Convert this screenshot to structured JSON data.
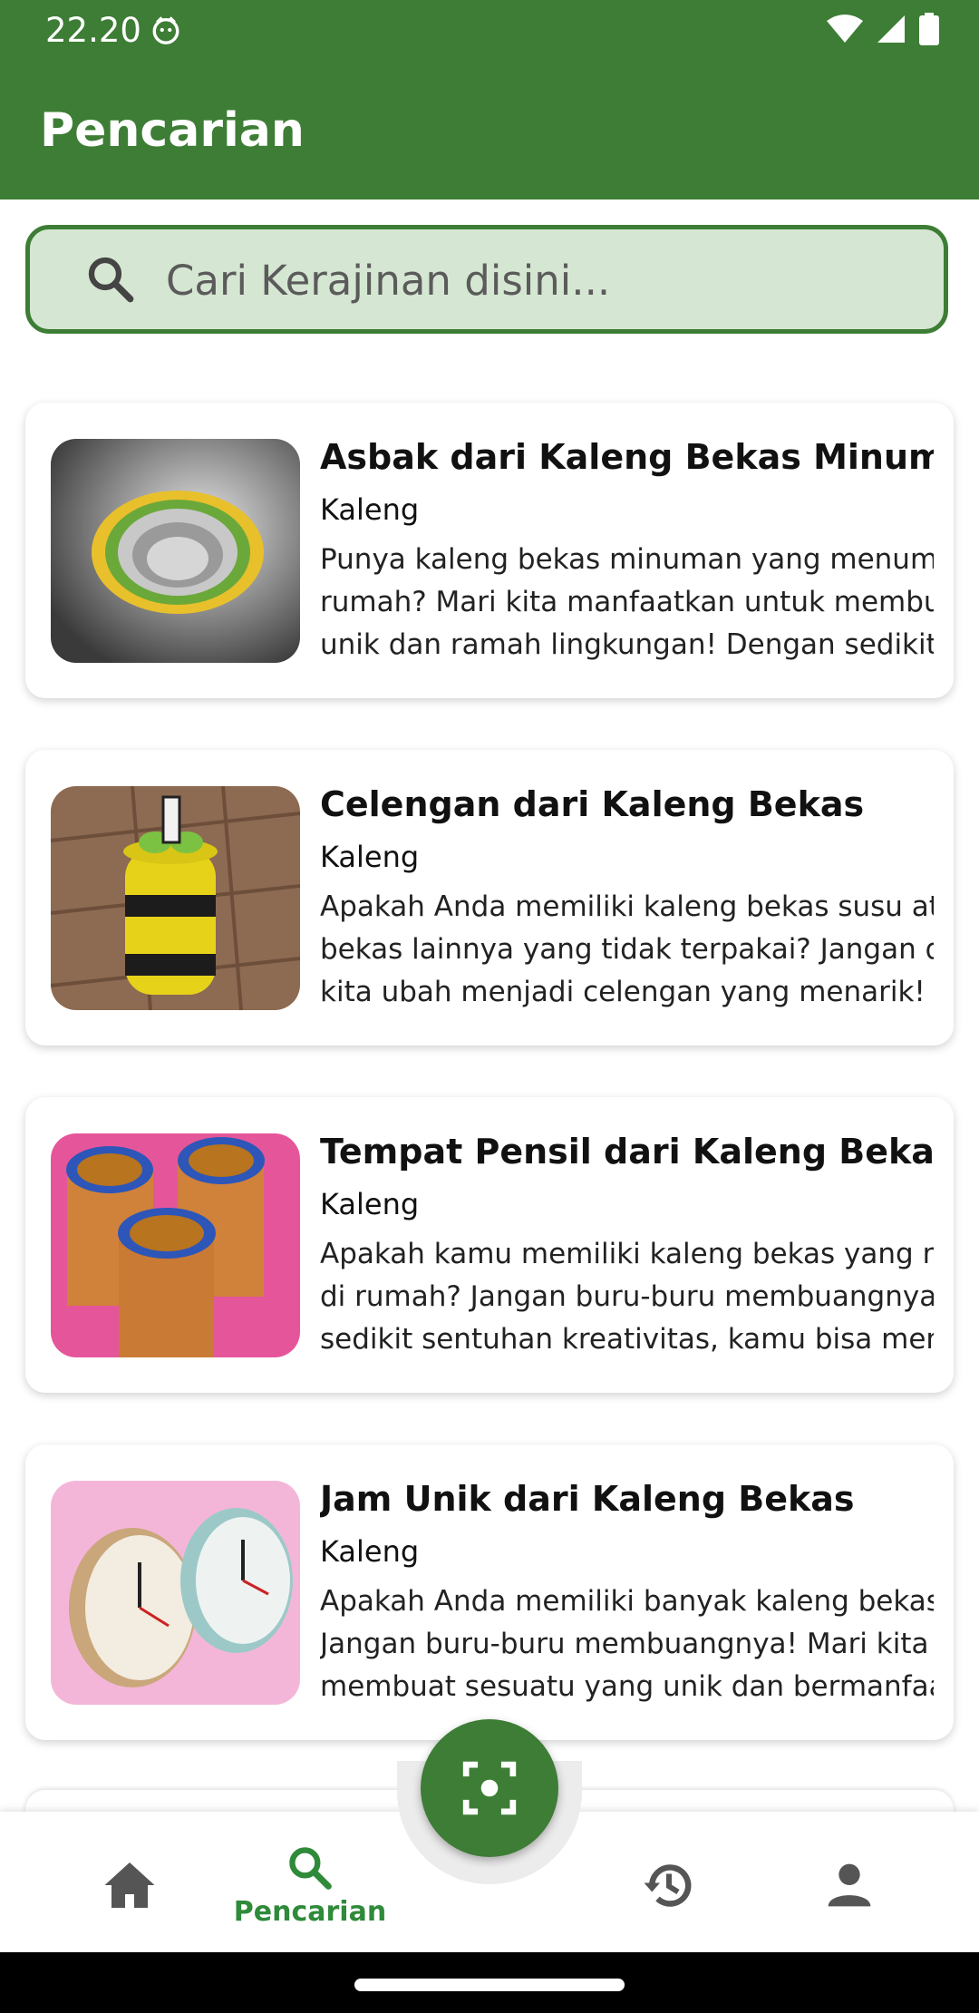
{
  "status_bar": {
    "time": "22.20"
  },
  "app_bar": {
    "title": "Pencarian"
  },
  "search": {
    "placeholder": "Cari Kerajinan disini..."
  },
  "items": [
    {
      "title": "Asbak dari Kaleng Bekas Minuman",
      "category": "Kaleng",
      "description": "Punya kaleng bekas minuman yang menumpuk di\nrumah? Mari kita manfaatkan untuk membuat asbak\nunik dan ramah lingkungan! Dengan sedikit kreativitas"
    },
    {
      "title": "Celengan dari Kaleng Bekas",
      "category": "Kaleng",
      "description": "Apakah Anda memiliki kaleng bekas susu atau kaleng\nbekas lainnya yang tidak terpakai? Jangan dibuang,\nkita ubah menjadi celengan yang menarik!"
    },
    {
      "title": "Tempat Pensil dari Kaleng Bekas",
      "category": "Kaleng",
      "description": "Apakah kamu memiliki kaleng bekas yang menumpuk\ndi rumah? Jangan buru-buru membuangnya! Dengan\nsedikit sentuhan kreativitas, kamu bisa mengubahnya"
    },
    {
      "title": "Jam Unik dari Kaleng Bekas",
      "category": "Kaleng",
      "description": "Apakah Anda memiliki banyak kaleng bekas di rumah?\nJangan buru-buru membuangnya! Mari kita\nmembuat sesuatu yang unik dan bermanfaat"
    }
  ],
  "bottom_nav": {
    "items": [
      {
        "icon": "home-icon",
        "label": ""
      },
      {
        "icon": "search-icon",
        "label": "Pencarian",
        "active": true
      },
      {
        "icon": "history-icon",
        "label": ""
      },
      {
        "icon": "person-icon",
        "label": ""
      }
    ],
    "fab_icon": "scan-icon"
  },
  "colors": {
    "primary": "#3d7d35",
    "search_fill": "#d5e7d2",
    "active_nav": "#2f8a3a",
    "inactive_nav": "#555555"
  }
}
